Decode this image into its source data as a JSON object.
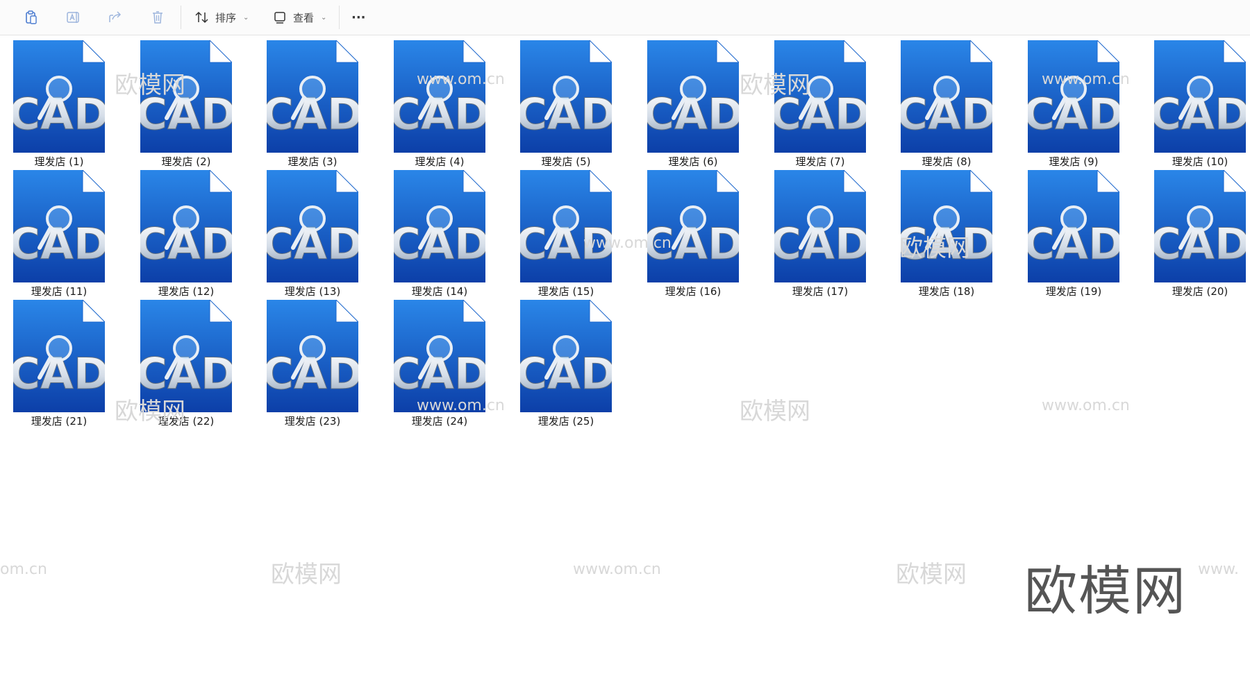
{
  "toolbar": {
    "sort_label": "排序",
    "view_label": "查看",
    "more_label": "···"
  },
  "icon_text": "CAD",
  "colors": {
    "file_blue_light": "#2a86e8",
    "file_blue_dark": "#0c3fa8",
    "fold": "#ffffff"
  },
  "files": [
    "理发店 (1)",
    "理发店 (2)",
    "理发店 (3)",
    "理发店 (4)",
    "理发店 (5)",
    "理发店 (6)",
    "理发店 (7)",
    "理发店 (8)",
    "理发店 (9)",
    "理发店 (10)",
    "理发店 (11)",
    "理发店 (12)",
    "理发店 (13)",
    "理发店 (14)",
    "理发店 (15)",
    "理发店 (16)",
    "理发店 (17)",
    "理发店 (18)",
    "理发店 (19)",
    "理发店 (20)",
    "理发店 (21)",
    "理发店 (22)",
    "理发店 (23)",
    "理发店 (24)",
    "理发店 (25)"
  ],
  "watermarks": {
    "brand": "欧模网",
    "url": "www.om.cn",
    "url_partial_left": "om.cn",
    "url_partial_right": "www."
  }
}
